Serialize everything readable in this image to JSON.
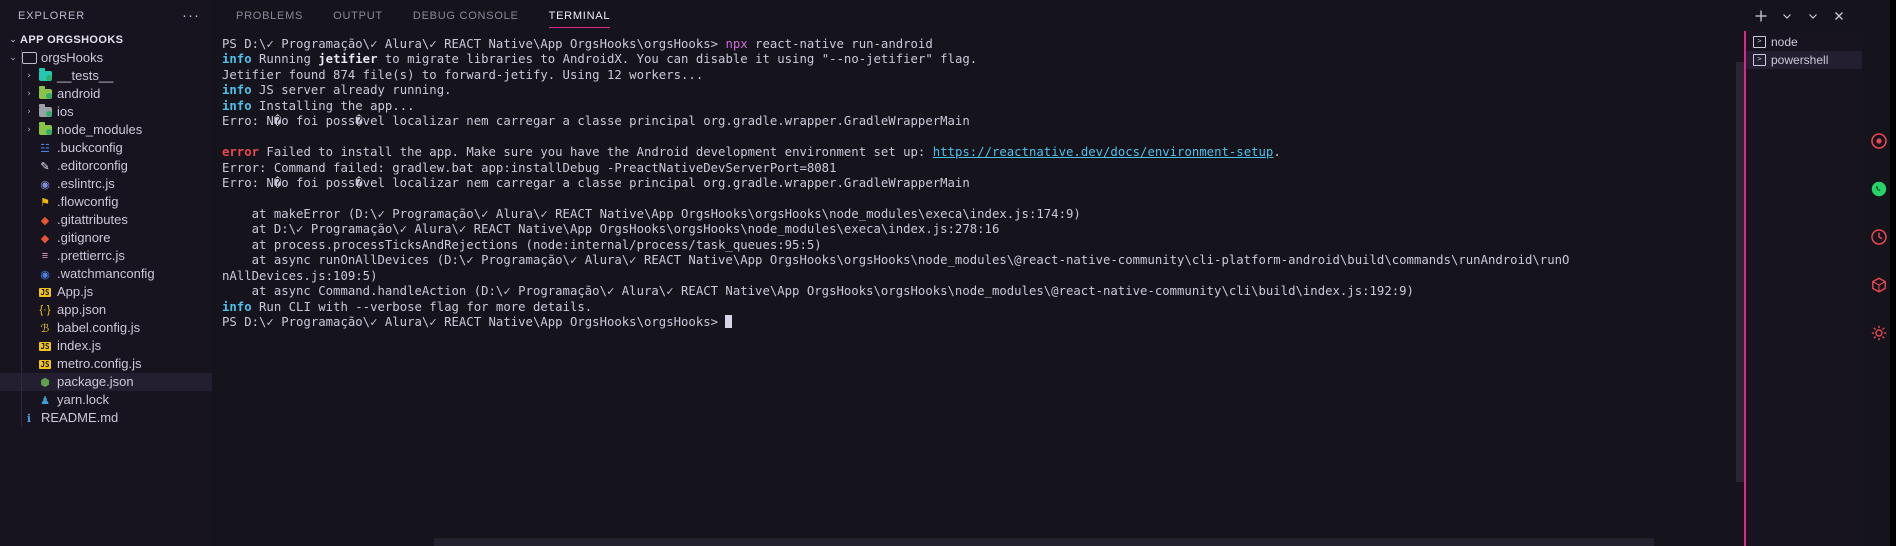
{
  "sidebar": {
    "title": "EXPLORER",
    "more_actions": "···",
    "root_label": "APP ORGSHOOKS",
    "root_twisty": "⌄",
    "items": [
      {
        "label": "orgsHooks",
        "indent": 1,
        "type": "folder",
        "expanded": true,
        "twisty": "⌄",
        "color": "#c0bbd0",
        "selected": false
      },
      {
        "label": "__tests__",
        "indent": 2,
        "type": "folder",
        "expanded": false,
        "twisty": "›",
        "color": "#24c8b0",
        "selected": false
      },
      {
        "label": "android",
        "indent": 2,
        "type": "folder",
        "expanded": false,
        "twisty": "›",
        "color": "#8bc34a",
        "selected": false
      },
      {
        "label": "ios",
        "indent": 2,
        "type": "folder",
        "expanded": false,
        "twisty": "›",
        "color": "#9aa0a6",
        "selected": false
      },
      {
        "label": "node_modules",
        "indent": 2,
        "type": "folder",
        "expanded": false,
        "twisty": "›",
        "color": "#8bc34a",
        "selected": false
      },
      {
        "label": ".buckconfig",
        "indent": 2,
        "type": "file",
        "icon": "buck-icon",
        "glyph": "☳",
        "color": "#4a7fe0",
        "selected": false
      },
      {
        "label": ".editorconfig",
        "indent": 2,
        "type": "file",
        "icon": "editorconfig-icon",
        "glyph": "✎",
        "color": "#e6e1ef",
        "selected": false
      },
      {
        "label": ".eslintrc.js",
        "indent": 2,
        "type": "file",
        "icon": "eslint-icon",
        "glyph": "◉",
        "color": "#7b8ed8",
        "selected": false
      },
      {
        "label": ".flowconfig",
        "indent": 2,
        "type": "file",
        "icon": "flow-icon",
        "glyph": "⚑",
        "color": "#f5b400",
        "selected": false
      },
      {
        "label": ".gitattributes",
        "indent": 2,
        "type": "file",
        "icon": "git-icon",
        "glyph": "◆",
        "color": "#e8542f",
        "selected": false
      },
      {
        "label": ".gitignore",
        "indent": 2,
        "type": "file",
        "icon": "git-icon",
        "glyph": "◆",
        "color": "#e8542f",
        "selected": false
      },
      {
        "label": ".prettierrc.js",
        "indent": 2,
        "type": "file",
        "icon": "prettier-icon",
        "glyph": "≡",
        "color": "#e0a3c8",
        "selected": false
      },
      {
        "label": ".watchmanconfig",
        "indent": 2,
        "type": "file",
        "icon": "watchman-icon",
        "glyph": "◉",
        "color": "#4a7fe0",
        "selected": false
      },
      {
        "label": "App.js",
        "indent": 2,
        "type": "file",
        "icon": "javascript-icon",
        "glyph": "JS",
        "color": "#f0c419",
        "selected": false
      },
      {
        "label": "app.json",
        "indent": 2,
        "type": "file",
        "icon": "json-icon",
        "glyph": "{·}",
        "color": "#f0c419",
        "selected": false
      },
      {
        "label": "babel.config.js",
        "indent": 2,
        "type": "file",
        "icon": "babel-icon",
        "glyph": "ℬ",
        "color": "#f0c419",
        "selected": false
      },
      {
        "label": "index.js",
        "indent": 2,
        "type": "file",
        "icon": "javascript-icon",
        "glyph": "JS",
        "color": "#f0c419",
        "selected": false
      },
      {
        "label": "metro.config.js",
        "indent": 2,
        "type": "file",
        "icon": "javascript-icon",
        "glyph": "JS",
        "color": "#f0c419",
        "selected": false
      },
      {
        "label": "package.json",
        "indent": 2,
        "type": "file",
        "icon": "nodejs-icon",
        "glyph": "⬢",
        "color": "#5fa04e",
        "selected": true
      },
      {
        "label": "yarn.lock",
        "indent": 2,
        "type": "file",
        "icon": "yarn-icon",
        "glyph": "♟",
        "color": "#3aa0d8",
        "selected": false
      },
      {
        "label": "README.md",
        "indent": 1,
        "type": "file",
        "icon": "info-icon",
        "glyph": "ℹ",
        "color": "#4a9de0",
        "selected": false
      }
    ]
  },
  "panel": {
    "tabs": [
      {
        "label": "PROBLEMS",
        "active": false
      },
      {
        "label": "OUTPUT",
        "active": false
      },
      {
        "label": "DEBUG CONSOLE",
        "active": false
      },
      {
        "label": "TERMINAL",
        "active": true
      }
    ],
    "active_tab_underline_color": "#e1268b",
    "actions": [
      {
        "name": "new-terminal-button",
        "label": "+"
      },
      {
        "name": "new-terminal-dropdown",
        "label": "⌄"
      },
      {
        "name": "panel-views-dropdown",
        "label": "⌄"
      },
      {
        "name": "close-panel-button",
        "label": "✕"
      }
    ]
  },
  "terminal_instances": [
    {
      "label": "node",
      "selected": false
    },
    {
      "label": "powershell",
      "selected": true
    }
  ],
  "terminal": {
    "lines": [
      [
        {
          "t": "PS D:\\✓ Programação\\✓ Alura\\✓ REACT Native\\App OrgsHooks\\orgsHooks> ",
          "c": "dim"
        },
        {
          "t": "npx",
          "c": "mag"
        },
        {
          "t": " react-native run-android",
          "c": "dim"
        }
      ],
      [
        {
          "t": "info",
          "c": "cyan"
        },
        {
          "t": " Running ",
          "c": "dim"
        },
        {
          "t": "jetifier",
          "c": "bold"
        },
        {
          "t": " to migrate libraries to AndroidX. You can disable it using \"--no-jetifier\" flag.",
          "c": "dim"
        }
      ],
      [
        {
          "t": "Jetifier found 874 file(s) to forward-jetify. Using 12 workers...",
          "c": "dim"
        }
      ],
      [
        {
          "t": "info",
          "c": "cyan"
        },
        {
          "t": " JS server already running.",
          "c": "dim"
        }
      ],
      [
        {
          "t": "info",
          "c": "cyan"
        },
        {
          "t": " Installing the app...",
          "c": "dim"
        }
      ],
      [
        {
          "t": "Erro: N�o foi poss�vel localizar nem carregar a classe principal org.gradle.wrapper.GradleWrapperMain",
          "c": "dim"
        }
      ],
      [
        {
          "t": "",
          "c": "dim"
        }
      ],
      [
        {
          "t": "error",
          "c": "red"
        },
        {
          "t": " Failed to install the app. Make sure you have the Android development environment set up: ",
          "c": "dim"
        },
        {
          "t": "https://reactnative.dev/docs/environment-setup",
          "c": "link"
        },
        {
          "t": ".",
          "c": "dim"
        }
      ],
      [
        {
          "t": "Error: Command failed: gradlew.bat app:installDebug -PreactNativeDevServerPort=8081",
          "c": "dim"
        }
      ],
      [
        {
          "t": "Erro: N�o foi poss�vel localizar nem carregar a classe principal org.gradle.wrapper.GradleWrapperMain",
          "c": "dim"
        }
      ],
      [
        {
          "t": "",
          "c": "dim"
        }
      ],
      [
        {
          "t": "    at makeError (D:\\✓ Programação\\✓ Alura\\✓ REACT Native\\App OrgsHooks\\orgsHooks\\node_modules\\execa\\index.js:174:9)",
          "c": "dim"
        }
      ],
      [
        {
          "t": "    at D:\\✓ Programação\\✓ Alura\\✓ REACT Native\\App OrgsHooks\\orgsHooks\\node_modules\\execa\\index.js:278:16",
          "c": "dim"
        }
      ],
      [
        {
          "t": "    at process.processTicksAndRejections (node:internal/process/task_queues:95:5)",
          "c": "dim"
        }
      ],
      [
        {
          "t": "    at async runOnAllDevices (D:\\✓ Programação\\✓ Alura\\✓ REACT Native\\App OrgsHooks\\orgsHooks\\node_modules\\@react-native-community\\cli-platform-android\\build\\commands\\runAndroid\\runO",
          "c": "dim"
        }
      ],
      [
        {
          "t": "nAllDevices.js:109:5)",
          "c": "dim"
        }
      ],
      [
        {
          "t": "    at async Command.handleAction (D:\\✓ Programação\\✓ Alura\\✓ REACT Native\\App OrgsHooks\\orgsHooks\\node_modules\\@react-native-community\\cli\\build\\index.js:192:9)",
          "c": "dim"
        }
      ],
      [
        {
          "t": "info",
          "c": "cyan"
        },
        {
          "t": " Run CLI with --verbose flag for more details.",
          "c": "dim"
        }
      ],
      [
        {
          "t": "PS D:\\✓ Programação\\✓ Alura\\✓ REACT Native\\App OrgsHooks\\orgsHooks> ",
          "c": "dim"
        },
        {
          "t": "█",
          "c": "cursor"
        }
      ]
    ]
  },
  "right_strip": {
    "icons": [
      {
        "name": "record-icon",
        "color": "#e8484f"
      },
      {
        "name": "whatsapp-icon",
        "color": "#25d366"
      },
      {
        "name": "history-icon",
        "color": "#e8484f"
      },
      {
        "name": "package-icon",
        "color": "#e8484f"
      },
      {
        "name": "gear-icon",
        "color": "#e8484f"
      }
    ]
  }
}
